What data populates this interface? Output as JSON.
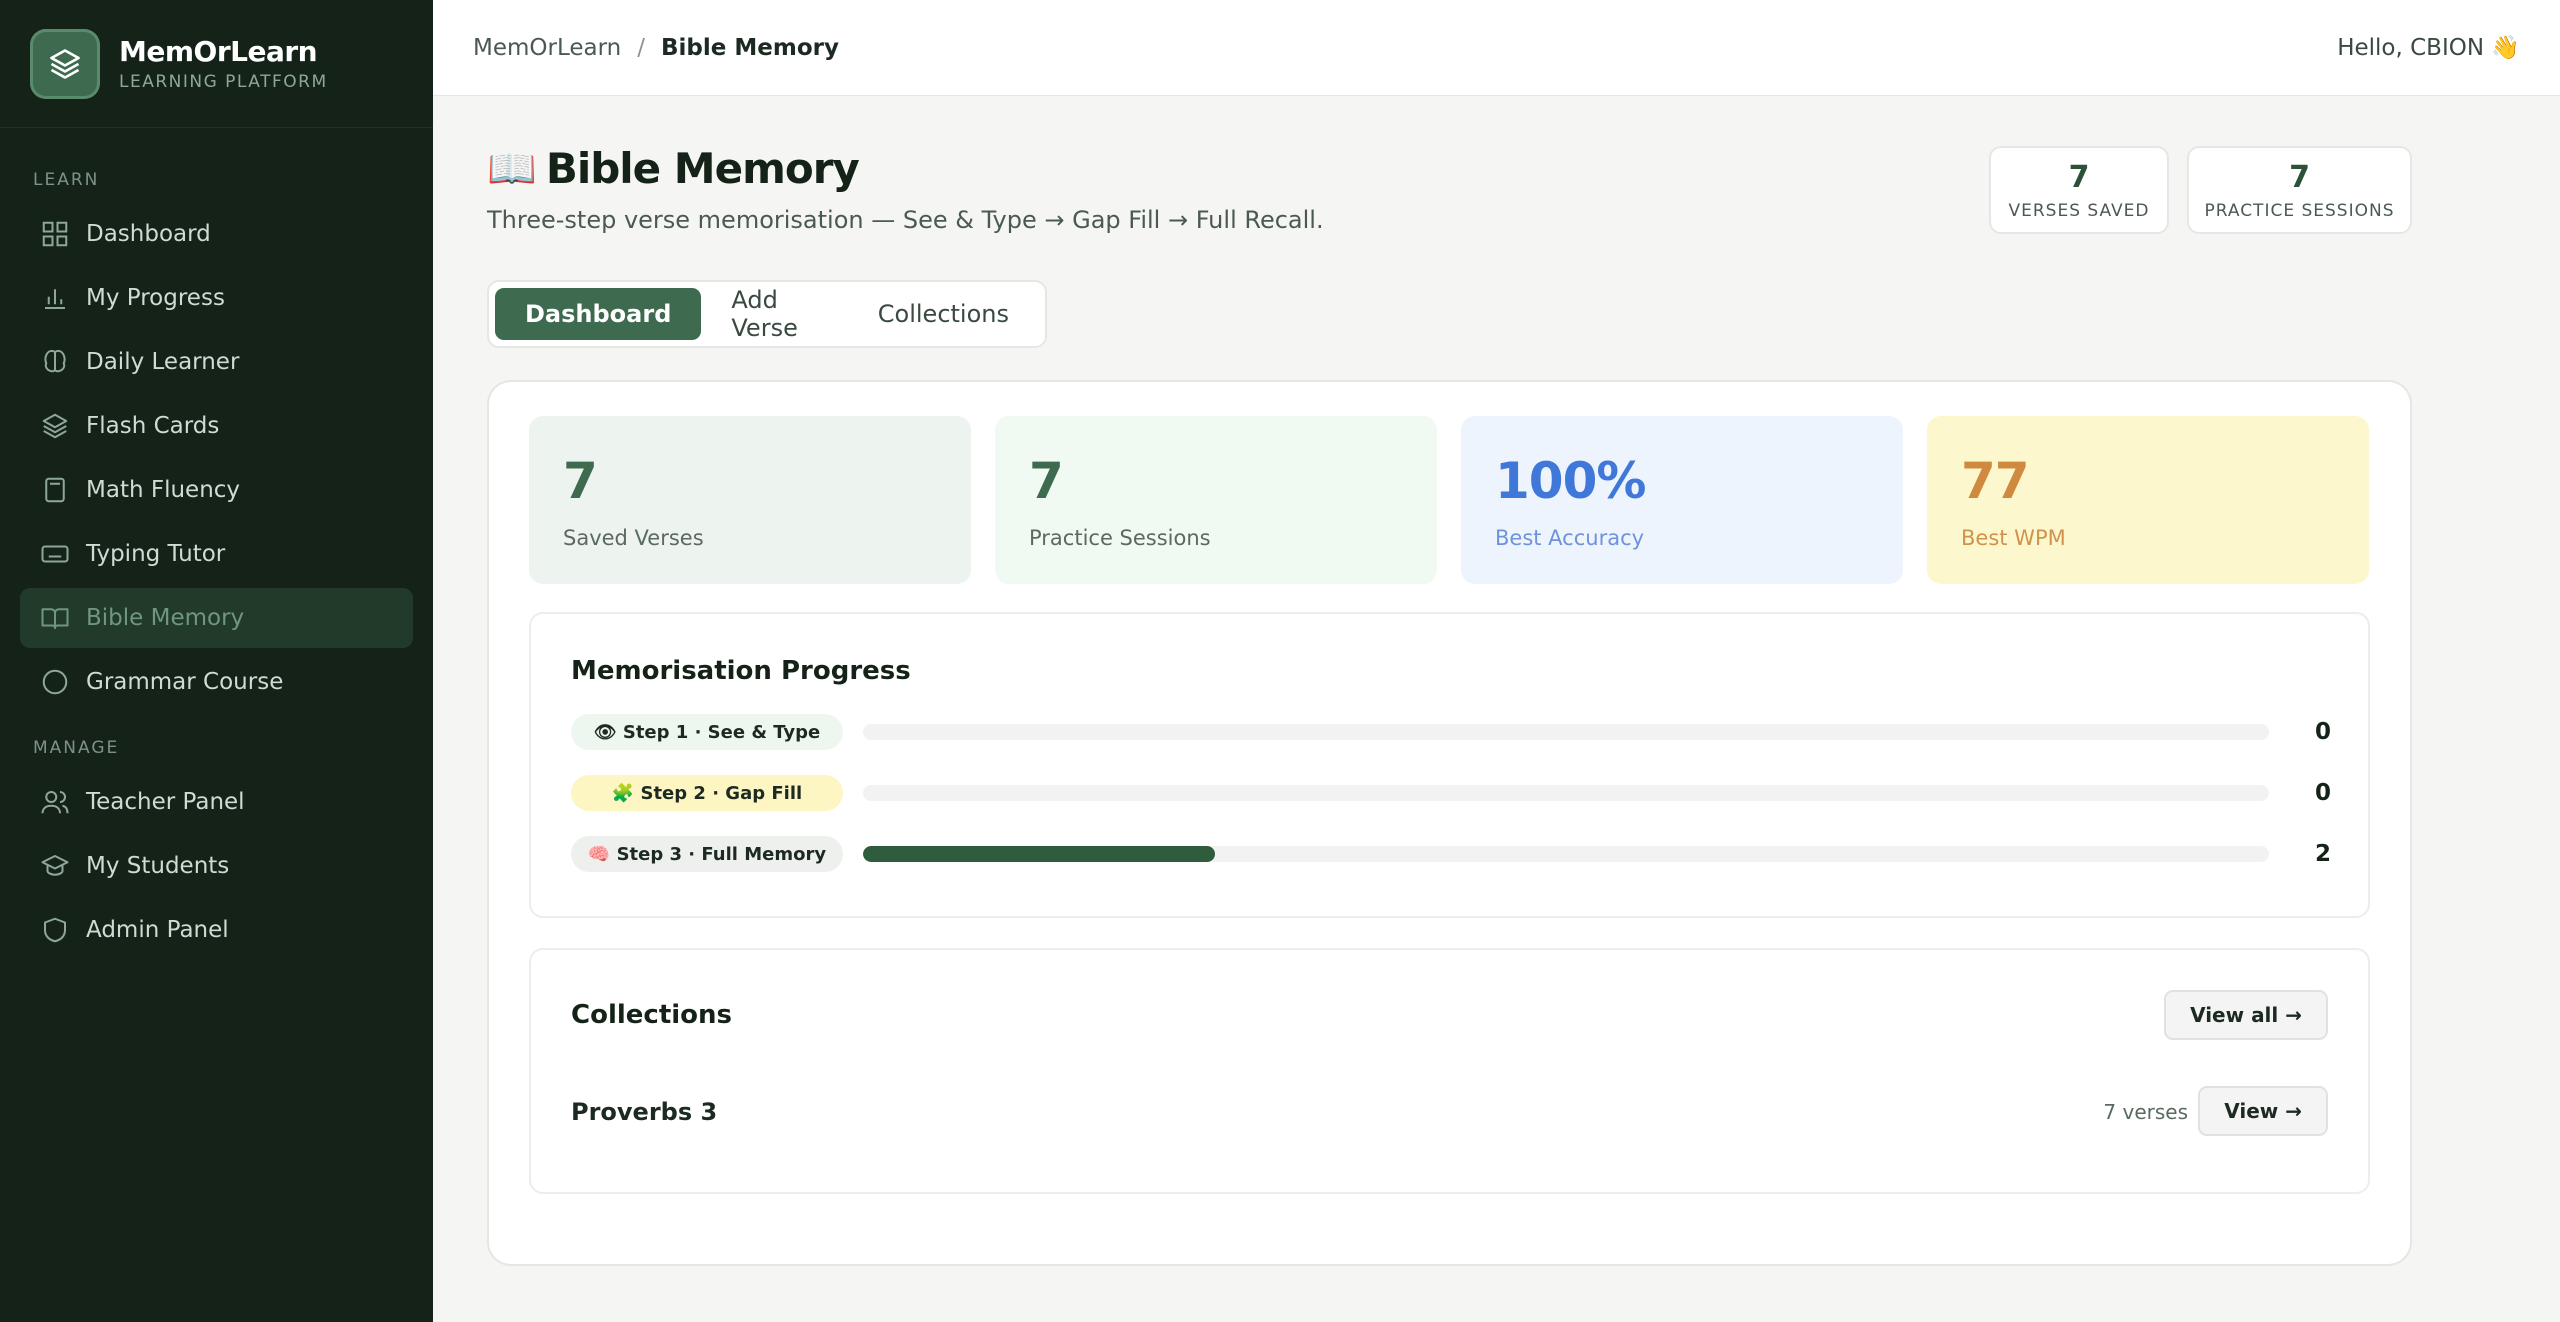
{
  "brand": {
    "name": "MemOrLearn",
    "subtitle": "LEARNING PLATFORM"
  },
  "sidebar": {
    "learn_label": "LEARN",
    "manage_label": "MANAGE",
    "learn_items": [
      {
        "label": "Dashboard",
        "icon": "grid-icon"
      },
      {
        "label": "My Progress",
        "icon": "bar-chart-icon"
      },
      {
        "label": "Daily Learner",
        "icon": "brain-icon"
      },
      {
        "label": "Flash Cards",
        "icon": "layers-icon"
      },
      {
        "label": "Math Fluency",
        "icon": "calculator-icon"
      },
      {
        "label": "Typing Tutor",
        "icon": "keyboard-icon"
      },
      {
        "label": "Bible Memory",
        "icon": "book-open-icon",
        "active": true
      },
      {
        "label": "Grammar Course",
        "icon": "circle-icon"
      }
    ],
    "manage_items": [
      {
        "label": "Teacher Panel",
        "icon": "users-icon"
      },
      {
        "label": "My Students",
        "icon": "graduation-cap-icon"
      },
      {
        "label": "Admin Panel",
        "icon": "shield-icon"
      }
    ]
  },
  "header": {
    "breadcrumb_root": "MemOrLearn",
    "breadcrumb_sep": "/",
    "breadcrumb_current": "Bible Memory",
    "greeting": "Hello, CBION 👋"
  },
  "page": {
    "icon": "📖",
    "title": "Bible Memory",
    "subtitle": "Three-step verse memorisation — See & Type → Gap Fill → Full Recall."
  },
  "header_stats": [
    {
      "value": "7",
      "label": "VERSES SAVED"
    },
    {
      "value": "7",
      "label": "PRACTICE SESSIONS"
    }
  ],
  "tabs": [
    {
      "label": "Dashboard",
      "active": true
    },
    {
      "label": "Add Verse"
    },
    {
      "label": "Collections"
    }
  ],
  "stats": [
    {
      "value": "7",
      "label": "Saved Verses",
      "bg": "#edf3ee",
      "color": "#3e6b4f",
      "label_color": "#5a6a60"
    },
    {
      "value": "7",
      "label": "Practice Sessions",
      "bg": "#f0faf2",
      "color": "#3e6b4f",
      "label_color": "#5a6a60"
    },
    {
      "value": "100%",
      "label": "Best Accuracy",
      "bg": "#eef4fd",
      "color": "#3f78d8",
      "label_color": "#6e93d8"
    },
    {
      "value": "77",
      "label": "Best WPM",
      "bg": "#fdf7cd",
      "color": "#d08a3f",
      "label_color": "#d0934d"
    }
  ],
  "progress": {
    "title": "Memorisation Progress",
    "max": 8,
    "steps": [
      {
        "label": "👁 Step 1 · See & Type",
        "count": 0,
        "count_label": "0",
        "bg": "#edf7ef"
      },
      {
        "label": "🧩 Step 2 · Gap Fill",
        "count": 0,
        "count_label": "0",
        "bg": "#fdf5c2"
      },
      {
        "label": "🧠 Step 3 · Full Memory",
        "count": 2,
        "count_label": "2",
        "bg": "#eef0ee"
      }
    ]
  },
  "collections": {
    "title": "Collections",
    "view_all": "View all →",
    "items": [
      {
        "name": "Proverbs 3",
        "count": "7 verses",
        "view": "View →"
      }
    ]
  },
  "colors": {
    "accent": "#3e6b4f",
    "sidebar_bg": "#142217",
    "bar_fill": "#2f5c3c"
  }
}
